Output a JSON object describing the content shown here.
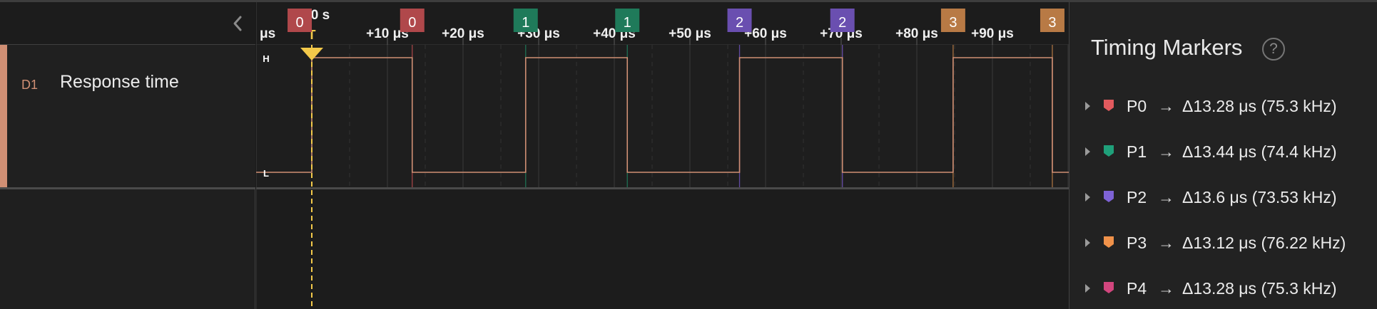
{
  "channel": {
    "id": "D1",
    "name": "Response time",
    "color": "#d08f74"
  },
  "timeline": {
    "unit_label": "μs",
    "trigger_time": "0 s",
    "trigger_label": "T",
    "ticks": [
      "+10 μs",
      "+20 μs",
      "+30 μs",
      "+40 μs",
      "+50 μs",
      "+60 μs",
      "+70 μs",
      "+80 μs",
      "+90 μs"
    ],
    "level_high": "H",
    "level_low": "L"
  },
  "waveform": {
    "initial_level": "L",
    "edge_times_us": [
      0,
      13.28,
      28.28,
      41.72,
      56.56,
      70.16,
      84.8,
      97.92
    ]
  },
  "marker_flags": [
    {
      "label": "0",
      "color": "#b0484b",
      "time_us": -1.6
    },
    {
      "label": "0",
      "color": "#b0484b",
      "time_us": 13.28
    },
    {
      "label": "1",
      "color": "#1f7a5a",
      "time_us": 28.28
    },
    {
      "label": "1",
      "color": "#1f7a5a",
      "time_us": 41.72
    },
    {
      "label": "2",
      "color": "#6a4fb0",
      "time_us": 56.56
    },
    {
      "label": "2",
      "color": "#6a4fb0",
      "time_us": 70.16
    },
    {
      "label": "3",
      "color": "#b87a45",
      "time_us": 84.8
    },
    {
      "label": "3",
      "color": "#b87a45",
      "time_us": 97.92
    }
  ],
  "panel": {
    "title": "Timing Markers",
    "help_icon": "question-circle-icon",
    "markers": [
      {
        "name": "P0",
        "value": "Δ13.28 μs (75.3 kHz)",
        "color": "#e25a5e"
      },
      {
        "name": "P1",
        "value": "Δ13.44 μs (74.4 kHz)",
        "color": "#1fa07a"
      },
      {
        "name": "P2",
        "value": "Δ13.6 μs (73.53 kHz)",
        "color": "#7e63d6"
      },
      {
        "name": "P3",
        "value": "Δ13.12 μs (76.22 kHz)",
        "color": "#f0924a"
      },
      {
        "name": "P4",
        "value": "Δ13.28 μs (75.3 kHz)",
        "color": "#d2467e"
      }
    ]
  }
}
